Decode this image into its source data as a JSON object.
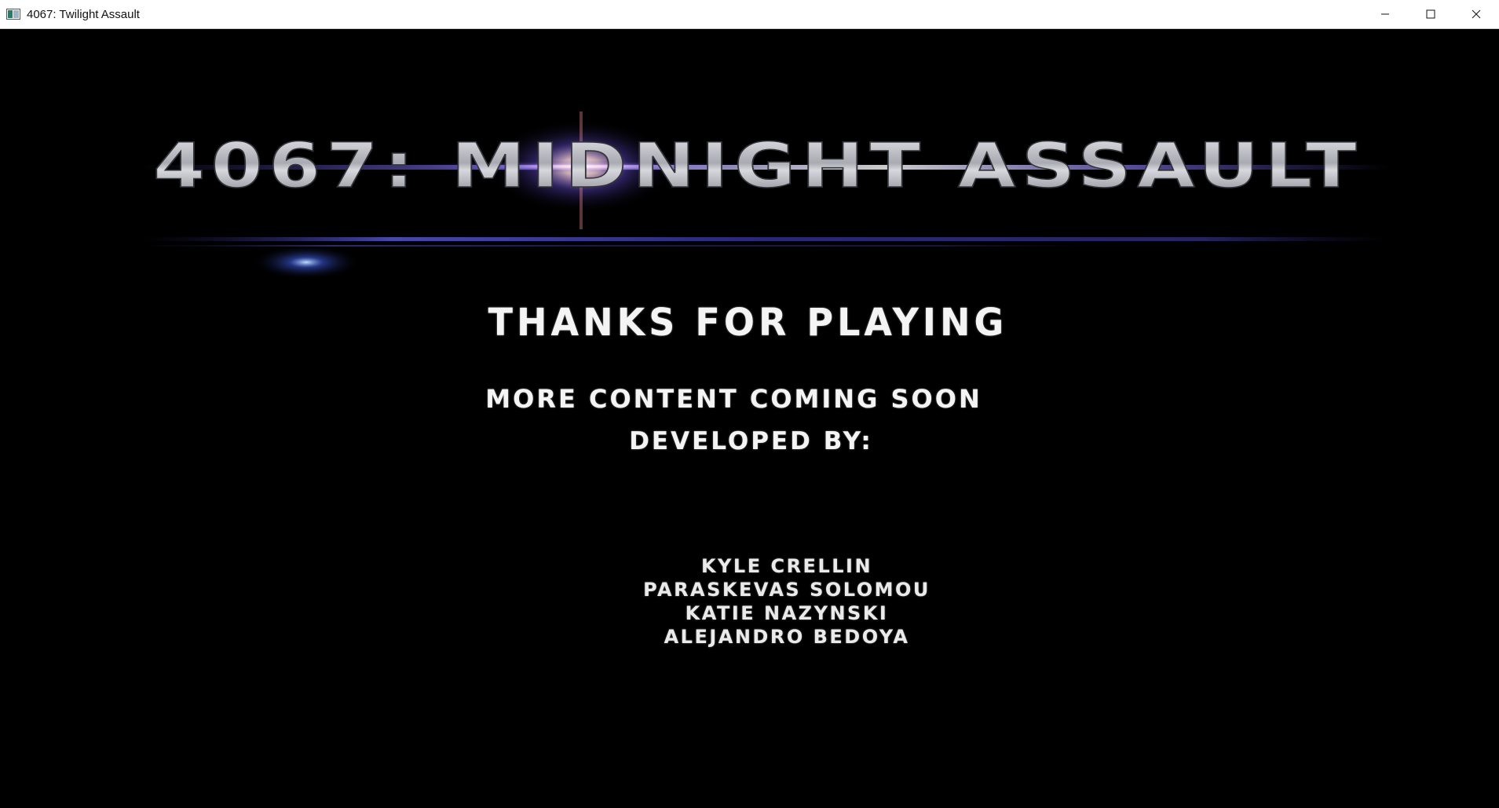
{
  "window": {
    "title": "4067: Twilight Assault",
    "controls": [
      "minimize-icon",
      "maximize-icon",
      "close-icon"
    ]
  },
  "logo": {
    "text": "4067: MIDNIGHT ASSAULT"
  },
  "credits": {
    "thanks": "THANKS FOR PLAYING",
    "more_content": "MORE CONTENT COMING SOON",
    "developed_by": "DEVELOPED BY:",
    "names": [
      "KYLE CRELLIN",
      "PARASKEVAS SOLOMOU",
      "KATIE NAZYNSKI",
      "ALEJANDRO BEDOYA"
    ]
  },
  "colors": {
    "background": "#000000",
    "titlebar": "#ffffff",
    "text": "#f4f4f4",
    "logo_metal": "#c8c8cc",
    "flare": "#6a5cff"
  }
}
